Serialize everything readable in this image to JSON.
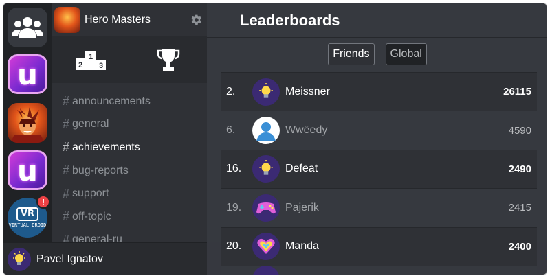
{
  "server": {
    "name": "Hero Masters"
  },
  "rail": {
    "u_tile_letter": "u",
    "vr_badge_text": "VR",
    "vr_caption": "VIRTUAL DROID",
    "alert_count": "!"
  },
  "channels": [
    {
      "label": "announcements",
      "active": false
    },
    {
      "label": "general",
      "active": false
    },
    {
      "label": "achievements",
      "active": true
    },
    {
      "label": "bug-reports",
      "active": false
    },
    {
      "label": "support",
      "active": false
    },
    {
      "label": "off-topic",
      "active": false
    },
    {
      "label": "general-ru",
      "active": false
    }
  ],
  "channel_hash": "#",
  "user": {
    "name": "Pavel Ignatov"
  },
  "main": {
    "title": "Leaderboards",
    "friends_label": "Friends",
    "global_label": "Global"
  },
  "leaderboard": [
    {
      "rank": "2.",
      "name": "Meissner",
      "score": "26115",
      "avatar": "lightbulb-icon"
    },
    {
      "rank": "6.",
      "name": "Wwëedy",
      "score": "4590",
      "avatar": "default-user-icon"
    },
    {
      "rank": "16.",
      "name": "Defeat",
      "score": "2490",
      "avatar": "lightbulb-icon"
    },
    {
      "rank": "19.",
      "name": "Pajerik",
      "score": "2415",
      "avatar": "gamepad-icon"
    },
    {
      "rank": "20.",
      "name": "Manda",
      "score": "2400",
      "avatar": "heart-icon"
    }
  ],
  "colors": {
    "accent_pink": "#ed4245",
    "brand_purple": "#7a2ad0"
  }
}
